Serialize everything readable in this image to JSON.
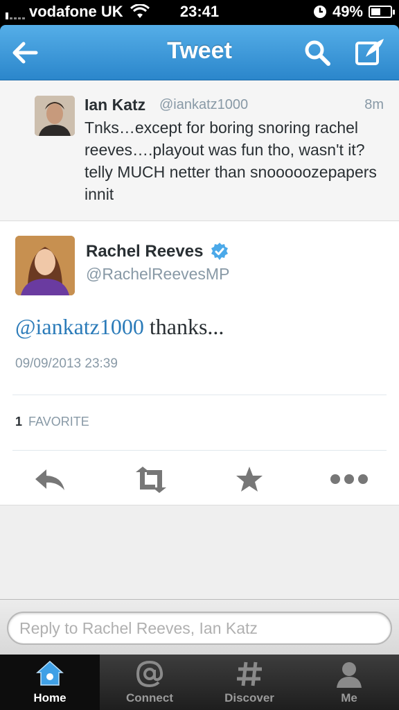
{
  "status_bar": {
    "carrier": "vodafone UK",
    "time": "23:41",
    "battery_percent": "49%",
    "battery_level": 0.49
  },
  "nav": {
    "title": "Tweet",
    "icons": [
      "back-arrow-icon",
      "search-icon",
      "compose-icon"
    ]
  },
  "parent_tweet": {
    "name": "Ian Katz",
    "handle": "@iankatz1000",
    "time": "8m",
    "text": "Tnks…except for boring  snoring rachel reeves….playout was fun tho, wasn't it? telly MUCH netter than snooooozepapers innit"
  },
  "main_tweet": {
    "name": "Rachel Reeves",
    "verified": true,
    "handle": "@RachelReevesMP",
    "mention": "@iankatz1000",
    "text": " thanks...",
    "date": "09/09/2013 23:39",
    "favorite_count": "1",
    "favorite_label": "FAVORITE",
    "actions": [
      "reply-icon",
      "retweet-icon",
      "favorite-icon",
      "more-icon"
    ]
  },
  "reply": {
    "placeholder": "Reply to Rachel Reeves, Ian Katz"
  },
  "tabs": [
    {
      "label": "Home",
      "icon": "home-icon",
      "active": true
    },
    {
      "label": "Connect",
      "icon": "at-icon",
      "active": false
    },
    {
      "label": "Discover",
      "icon": "hashtag-icon",
      "active": false
    },
    {
      "label": "Me",
      "icon": "person-icon",
      "active": false
    }
  ],
  "colors": {
    "nav_blue": "#2b86cb",
    "link_blue": "#2b7bb9",
    "verified_blue": "#4ba9e9",
    "tab_active_blue": "#3fa0e6"
  }
}
